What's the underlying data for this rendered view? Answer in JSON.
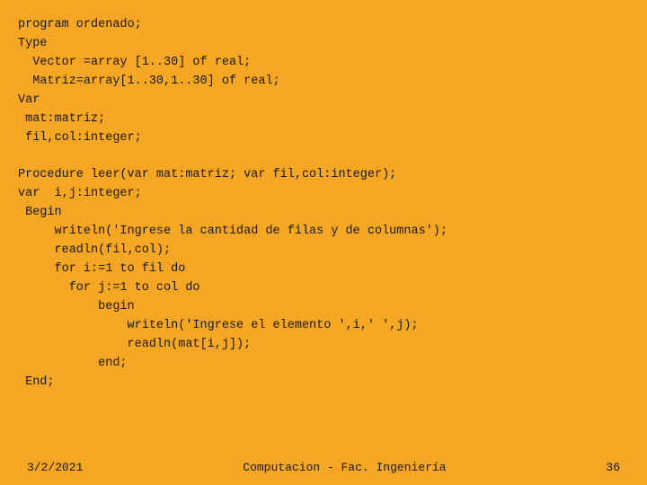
{
  "slide": {
    "background_color": "#f5a623",
    "code": {
      "lines": [
        "program ordenado;",
        "Type",
        "  Vector =array [1..30] of real;",
        "  Matriz=array[1..30,1..30] of real;",
        "Var",
        " mat:matriz;",
        " fil,col:integer;",
        "",
        "Procedure leer(var mat:matriz; var fil,col:integer);",
        "var  i,j:integer;",
        " Begin",
        "     writeln('Ingrese la cantidad de filas y de columnas');",
        "     readln(fil,col);",
        "     for i:=1 to fil do",
        "       for j:=1 to col do",
        "           begin",
        "               writeln('Ingrese el elemento ',i,' ',j);",
        "               readln(mat[i,j]);",
        "           end;",
        " End;"
      ]
    },
    "footer": {
      "date": "3/2/2021",
      "title": "Computacion  - Fac. Ingeniería",
      "page": "36"
    }
  }
}
